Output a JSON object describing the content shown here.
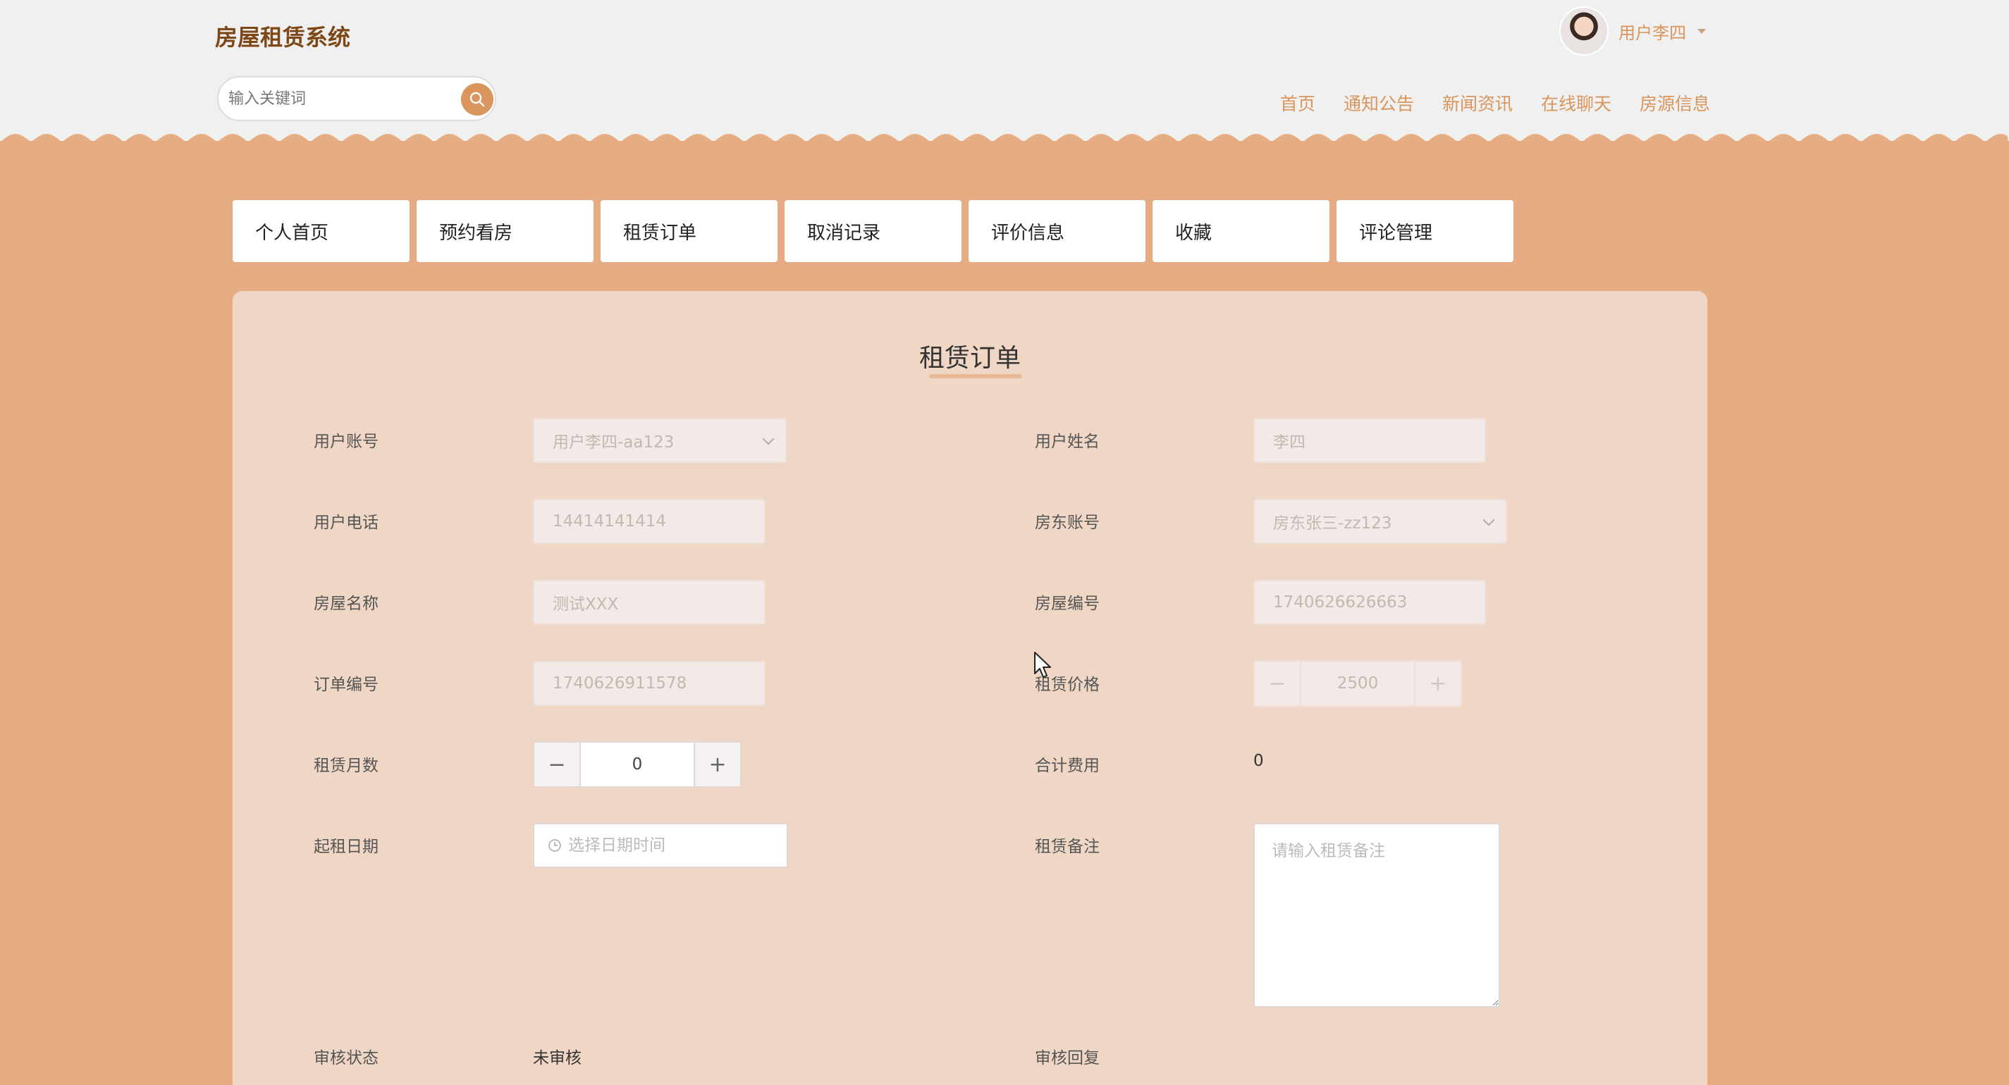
{
  "header": {
    "brand": "房屋租赁系统",
    "search_placeholder": "输入关键词",
    "user_name": "用户李四",
    "nav": [
      "首页",
      "通知公告",
      "新闻资讯",
      "在线聊天",
      "房源信息"
    ]
  },
  "tabs": [
    "个人首页",
    "预约看房",
    "租赁订单",
    "取消记录",
    "评价信息",
    "收藏",
    "评论管理"
  ],
  "form": {
    "title": "租赁订单",
    "fields": {
      "user_account": {
        "label": "用户账号",
        "value": "用户李四-aa123"
      },
      "user_name": {
        "label": "用户姓名",
        "value": "李四"
      },
      "user_phone": {
        "label": "用户电话",
        "value": "14414141414"
      },
      "landlord_account": {
        "label": "房东账号",
        "value": "房东张三-zz123"
      },
      "house_name": {
        "label": "房屋名称",
        "value": "测试XXX"
      },
      "house_no": {
        "label": "房屋编号",
        "value": "1740626626663"
      },
      "order_no": {
        "label": "订单编号",
        "value": "1740626911578"
      },
      "rent_price": {
        "label": "租赁价格",
        "value": "2500"
      },
      "rent_months": {
        "label": "租赁月数",
        "value": "0"
      },
      "total_cost": {
        "label": "合计费用",
        "value": "0"
      },
      "start_date": {
        "label": "起租日期",
        "placeholder": "选择日期时间"
      },
      "remark": {
        "label": "租赁备注",
        "placeholder": "请输入租赁备注"
      },
      "audit_status": {
        "label": "审核状态",
        "value": "未审核"
      },
      "audit_reply": {
        "label": "审核回复"
      }
    },
    "stepper_minus": "−",
    "stepper_plus": "+"
  },
  "colors": {
    "background": "#e6ad84",
    "panel": "#f0d7c5",
    "accent": "#d9955c",
    "brand": "#7d4816"
  }
}
